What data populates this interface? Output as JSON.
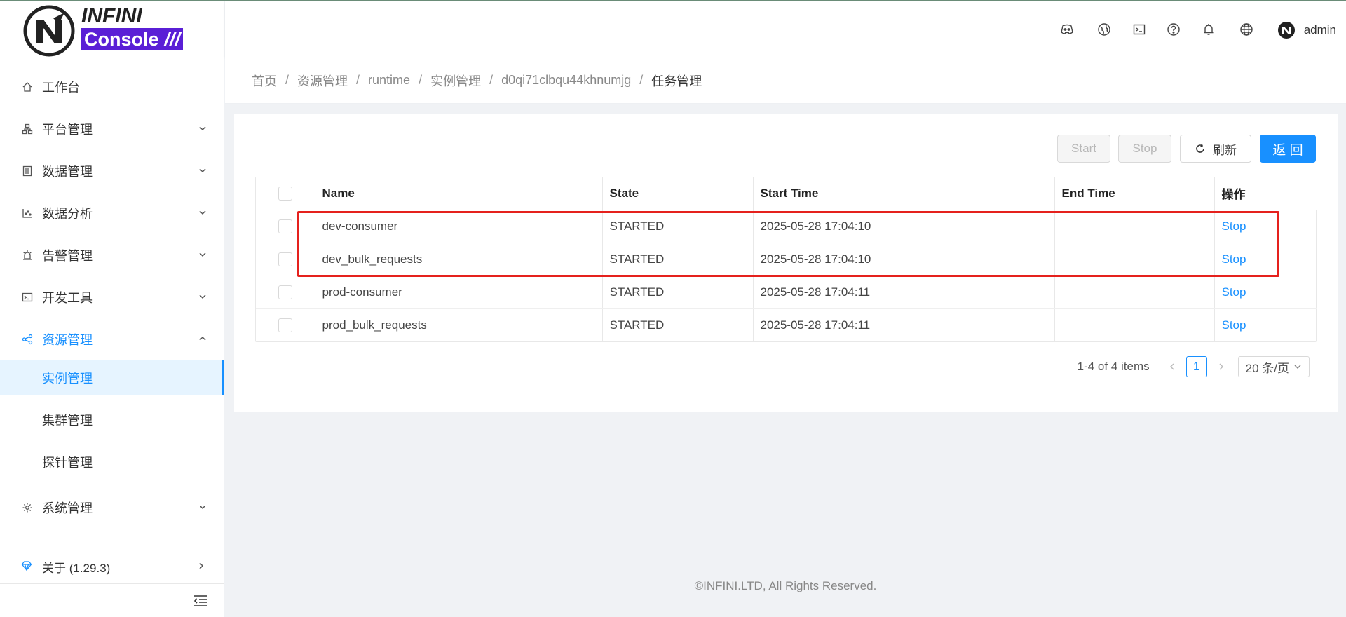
{
  "app": {
    "logo_word1": "INFINI",
    "logo_word2": "Console",
    "brand_color": "#5a1fd6"
  },
  "header": {
    "icons": [
      "discord-icon",
      "website-icon",
      "console-icon",
      "help-icon",
      "bell-icon",
      "language-icon"
    ],
    "username": "admin"
  },
  "sidebar": {
    "items": [
      {
        "label": "工作台",
        "icon": "home-icon"
      },
      {
        "label": "平台管理",
        "icon": "cluster-icon"
      },
      {
        "label": "数据管理",
        "icon": "database-icon"
      },
      {
        "label": "数据分析",
        "icon": "chart-icon"
      },
      {
        "label": "告警管理",
        "icon": "alarm-icon"
      },
      {
        "label": "开发工具",
        "icon": "terminal-icon"
      },
      {
        "label": "资源管理",
        "icon": "share-icon"
      }
    ],
    "subitems": [
      {
        "label": "实例管理"
      },
      {
        "label": "集群管理"
      },
      {
        "label": "探针管理"
      }
    ],
    "system": {
      "label": "系统管理",
      "icon": "gear-icon"
    },
    "about": {
      "label": "关于 (1.29.3)",
      "icon": "diamond-icon"
    }
  },
  "breadcrumb": [
    "首页",
    "资源管理",
    "runtime",
    "实例管理",
    "d0qi71clbqu44khnumjg",
    "任务管理"
  ],
  "toolbar": {
    "start_label": "Start",
    "stop_label": "Stop",
    "refresh_label": "刷新",
    "back_label": "返 回"
  },
  "table": {
    "columns": [
      "Name",
      "State",
      "Start Time",
      "End Time",
      "操作"
    ],
    "rows": [
      {
        "name": "dev-consumer",
        "state": "STARTED",
        "start_time": "2025-05-28 17:04:10",
        "end_time": "",
        "action": "Stop"
      },
      {
        "name": "dev_bulk_requests",
        "state": "STARTED",
        "start_time": "2025-05-28 17:04:10",
        "end_time": "",
        "action": "Stop"
      },
      {
        "name": "prod-consumer",
        "state": "STARTED",
        "start_time": "2025-05-28 17:04:11",
        "end_time": "",
        "action": "Stop"
      },
      {
        "name": "prod_bulk_requests",
        "state": "STARTED",
        "start_time": "2025-05-28 17:04:11",
        "end_time": "",
        "action": "Stop"
      }
    ]
  },
  "pagination": {
    "total_text": "1-4 of 4 items",
    "current_page": "1",
    "page_size": "20 条/页"
  },
  "footer": "©INFINI.LTD, All Rights Reserved.",
  "colors": {
    "primary": "#1890ff",
    "highlight_box": "#e5211d"
  }
}
